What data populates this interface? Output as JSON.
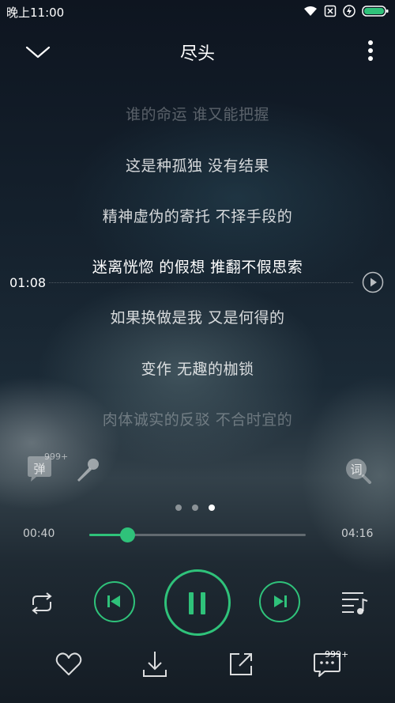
{
  "status_bar": {
    "time": "晚上11:00",
    "icons": [
      "wifi-icon",
      "sim-off-icon",
      "charging-icon",
      "battery-icon"
    ],
    "battery_color": "#2fc27a"
  },
  "header": {
    "title": "尽头",
    "collapse_icon": "chevron-down-icon",
    "more_icon": "more-vertical-icon"
  },
  "lyrics": {
    "lines": [
      "谁的命运 谁又能把握",
      "这是种孤独 没有结果",
      "精神虚伪的寄托 不择手段的",
      "迷离恍惚 的假想 推翻不假思索",
      "如果换做是我 又是何得的",
      "变作 无趣的枷锁",
      "肉体诚实的反驳 不合时宜的"
    ],
    "seek_time": "01:08"
  },
  "tools": {
    "danmu_label": "弹",
    "danmu_count": "999+",
    "lyric_label": "词"
  },
  "pager": {
    "count": 3,
    "active_index": 2
  },
  "progress": {
    "current": "00:40",
    "total": "04:16",
    "fraction": 0.18,
    "accent": "#2fc27a"
  },
  "controls": {
    "repeat_icon": "repeat-icon",
    "prev_icon": "skip-previous-icon",
    "play_state": "playing",
    "next_icon": "skip-next-icon",
    "queue_icon": "playlist-icon"
  },
  "bottom_bar": {
    "comment_count": "999+"
  }
}
